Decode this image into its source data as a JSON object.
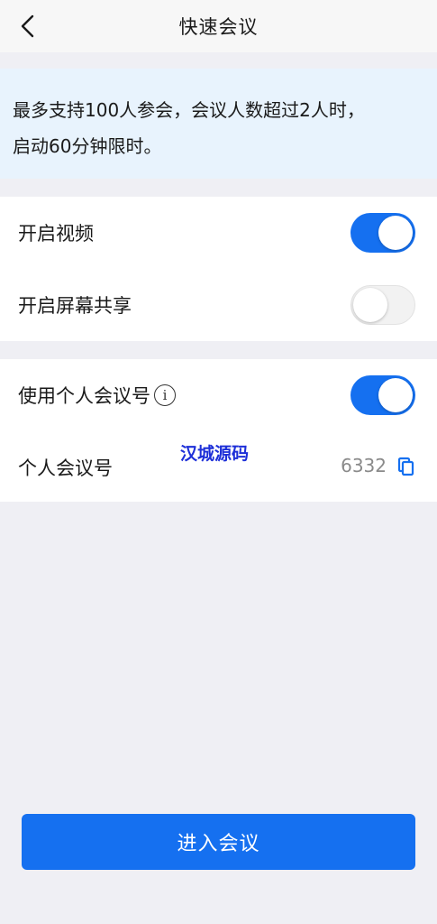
{
  "header": {
    "title": "快速会议",
    "back_icon": "chevron-left-icon"
  },
  "notice": {
    "line1": "最多支持100人参会，会议人数超过2人时，",
    "line2": "启动60分钟限时。"
  },
  "settings": {
    "video": {
      "label": "开启视频",
      "enabled": true
    },
    "screen_share": {
      "label": "开启屏幕共享",
      "enabled": false
    },
    "personal_meeting_id": {
      "label": "使用个人会议号",
      "enabled": true,
      "info_icon": "info-icon"
    }
  },
  "personal_meeting": {
    "label": "个人会议号",
    "number": "6332",
    "copy_icon": "copy-icon"
  },
  "watermark": "汉城源码",
  "actions": {
    "enter_label": "进入会议"
  },
  "colors": {
    "accent": "#1570f0",
    "banner": "#e8f3fd",
    "background": "#efeff4"
  }
}
